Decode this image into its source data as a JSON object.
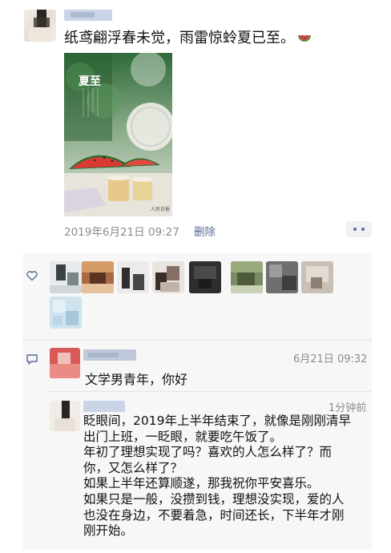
{
  "post": {
    "text": "纸鸢翩浮春未觉，雨雷惊蛉夏已至。",
    "image_title": "夏至",
    "image_watermark": "人民日报",
    "date": "2019年6月21日 09:27",
    "delete_label": "删除"
  },
  "likes": {
    "icon": "heart-icon",
    "avatars": [
      "liker-1",
      "liker-2",
      "liker-3",
      "liker-4",
      "liker-5",
      "liker-6",
      "liker-7",
      "liker-8",
      "liker-9"
    ]
  },
  "comments": [
    {
      "time": "6月21日 09:32",
      "text": "文学男青年，你好"
    },
    {
      "time": "1分钟前",
      "lines": [
        "眨眼间，2019年上半年结束了，就像是刚刚清早",
        "出门上班，一眨眼，就要吃午饭了。",
        "年初了理想实现了吗？喜欢的人怎么样了？而",
        "你，又怎么样了？",
        "如果上半年还算顺遂，那我祝你平安喜乐。",
        "如果只是一般，没攒到钱，理想没实现，爱的人",
        "也没在身边，不要着急，时间还长，下半年才刚",
        "刚开始。"
      ]
    }
  ],
  "colors": {
    "link": "#576b95",
    "meta": "#8c8c8c",
    "panel": "#f7f7f7"
  }
}
